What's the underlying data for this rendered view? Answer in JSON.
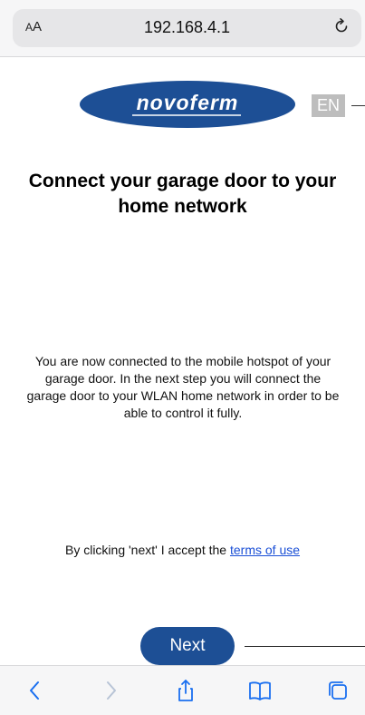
{
  "browser": {
    "text_size_label": "AA",
    "url": "192.168.4.1"
  },
  "header": {
    "logo_text": "novoferm",
    "language": "EN"
  },
  "main": {
    "title": "Connect your garage door to your home network",
    "description": "You are now connected to the mobile hotspot of your garage door. In the next step you will connect the garage door to your WLAN home network in order to be able to control it fully.",
    "terms_prefix": "By clicking 'next' I accept the ",
    "terms_link": "terms of use",
    "next_label": "Next"
  },
  "colors": {
    "brand_blue": "#1d4f95",
    "link_blue": "#1a4fd6",
    "toolbar_icon_blue": "#1a6ff0",
    "badge_gray": "#bdbdbd"
  },
  "toolbar": {
    "icons": [
      "back-icon",
      "forward-icon",
      "share-icon",
      "bookmarks-icon",
      "tabs-icon"
    ]
  }
}
